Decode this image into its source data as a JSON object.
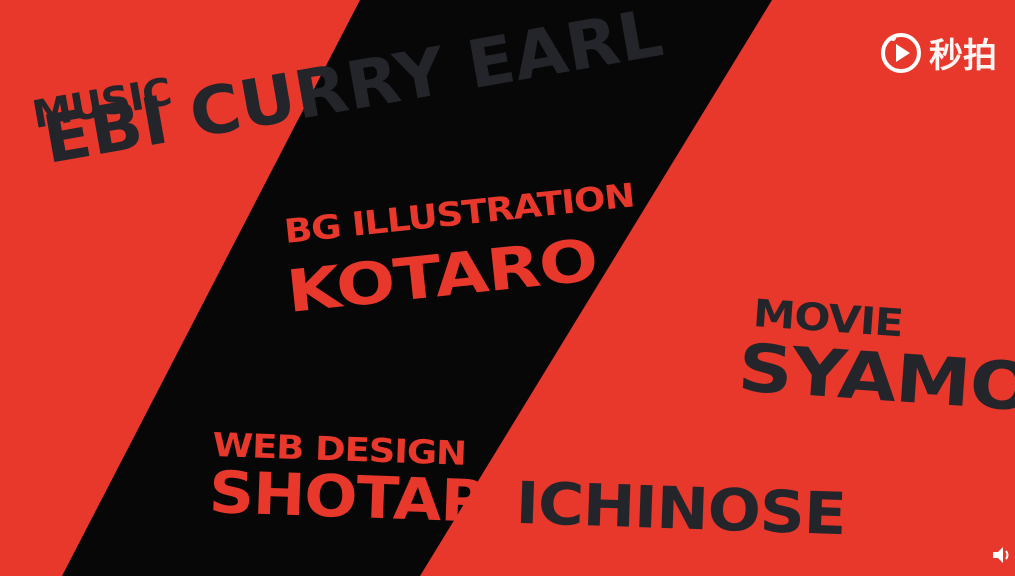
{
  "credits": {
    "music": {
      "label": "MUSIC",
      "name": "EBI CURRY EARL"
    },
    "bg_illustration": {
      "label": "BG ILLUSTRATION",
      "name": "KOTARO"
    },
    "movie": {
      "label": "MOVIE",
      "name": "SYAMO"
    },
    "web_design": {
      "label": "WEB DESIGN",
      "name_part1": "SHOTARO",
      "name_part2": " ICHINOSE"
    }
  },
  "watermark": {
    "text": "秒拍",
    "icon": "play-circle-icon"
  },
  "controls": {
    "volume_icon": "volume-icon"
  },
  "colors": {
    "background_red": "#e8382c",
    "band_black": "#070707",
    "text_dark": "#24252a",
    "watermark": "#ffffff"
  }
}
